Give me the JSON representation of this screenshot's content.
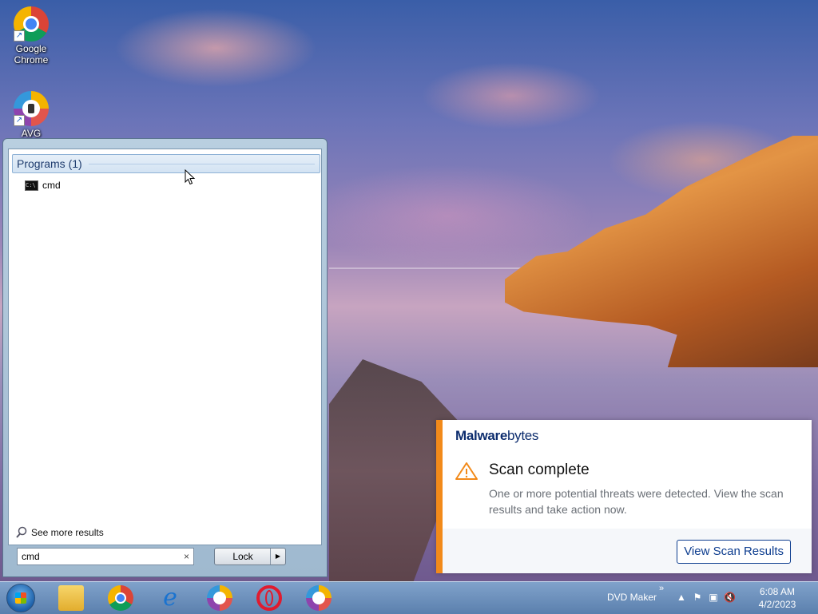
{
  "desktop": {
    "icons": [
      {
        "label": "Google Chrome",
        "icon": "chrome-icon"
      },
      {
        "label": "AVG Secure",
        "icon": "avg-secure-browser-icon"
      }
    ]
  },
  "start_menu": {
    "section_header": "Programs (1)",
    "results": [
      {
        "label": "cmd",
        "icon": "cmd-icon"
      }
    ],
    "see_more_label": "See more results",
    "search_value": "cmd",
    "search_clear": "×",
    "lock_label": "Lock",
    "lock_arrow": "▶"
  },
  "toast": {
    "brand_bold": "Malware",
    "brand_normal": "bytes",
    "title": "Scan complete",
    "message": "One or more potential threats were detected. View the scan results and take action now.",
    "button_label": "View Scan Results",
    "accent_color": "#f28a1a",
    "brand_color": "#0d2d6e"
  },
  "taskbar": {
    "pinned": [
      "windows-explorer-icon",
      "chrome-icon",
      "internet-explorer-icon",
      "avg-secure-browser-icon",
      "opera-icon",
      "avg-secure-browser-icon"
    ],
    "toolbar_label": "DVD Maker",
    "toolbar_chevron": "»",
    "tray_up": "▲",
    "clock_time": "6:08 AM",
    "clock_date": "4/2/2023"
  }
}
